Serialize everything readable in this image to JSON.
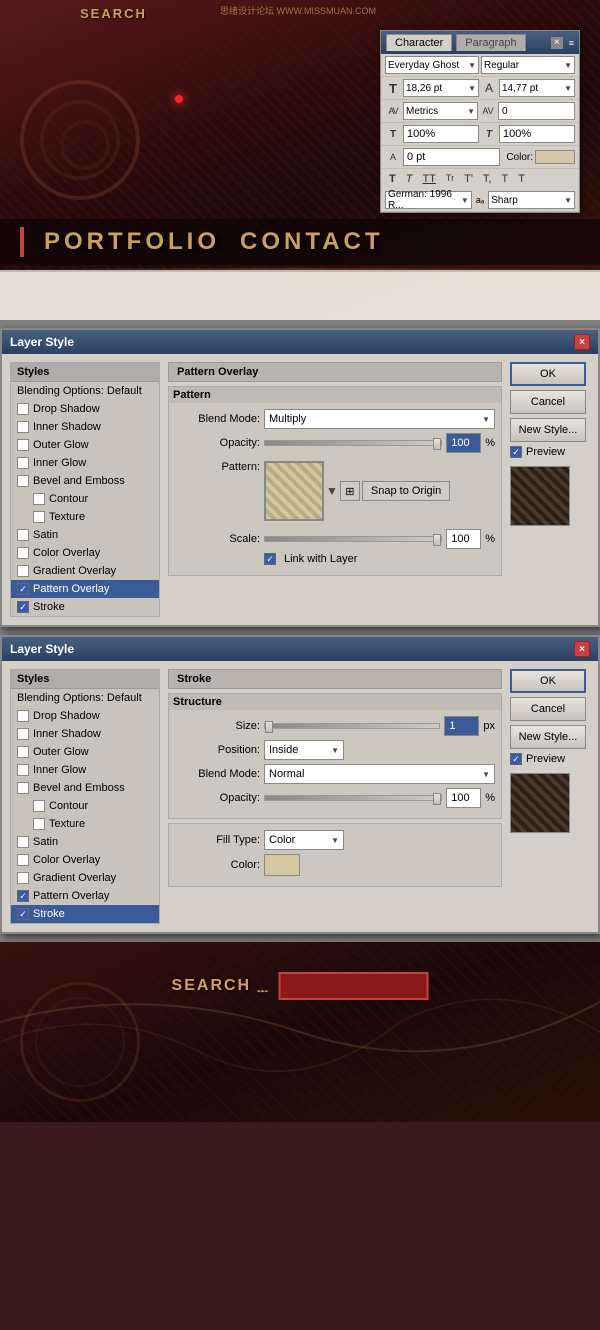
{
  "website": {
    "search_label": "SEARCH",
    "site_title": "思绪设计论坛 WWW.MISSMUAN.COM",
    "nav": {
      "portfolio": "PORTFOLIO",
      "contact": "CONTACT"
    }
  },
  "character_panel": {
    "title": "Character",
    "close": "×",
    "tabs": [
      "Character",
      "Paragraph"
    ],
    "font_family": "Everyday Ghost",
    "font_style": "Regular",
    "font_size": "18,26 pt",
    "leading": "14,77 pt",
    "tracking_label": "AV",
    "tracking_value": "Metrics",
    "kerning_label": "AV",
    "kerning_value": "0",
    "scale_h": "100%",
    "scale_v": "100%",
    "baseline": "0 pt",
    "color_label": "Color:",
    "language": "German: 1996 R...",
    "anti_alias": "Sharp",
    "text_buttons": [
      "T",
      "T",
      "TT",
      "Tr",
      "T'",
      "T,",
      "T",
      "T"
    ]
  },
  "layer_style_1": {
    "title": "Layer Style",
    "active_section": "Pattern Overlay",
    "sections": {
      "header": "Pattern Overlay",
      "sub_header": "Pattern"
    },
    "blend_mode": "Multiply",
    "opacity": "100",
    "opacity_percent": "%",
    "scale": "100",
    "scale_percent": "%",
    "link_layer": "Link with Layer",
    "snap_origin": "Snap to Origin",
    "styles_list": [
      {
        "label": "Styles",
        "type": "header"
      },
      {
        "label": "Blending Options: Default",
        "type": "item"
      },
      {
        "label": "Drop Shadow",
        "type": "checkbox"
      },
      {
        "label": "Inner Shadow",
        "type": "checkbox"
      },
      {
        "label": "Outer Glow",
        "type": "checkbox"
      },
      {
        "label": "Inner Glow",
        "type": "checkbox"
      },
      {
        "label": "Bevel and Emboss",
        "type": "checkbox"
      },
      {
        "label": "Contour",
        "type": "checkbox-indent"
      },
      {
        "label": "Texture",
        "type": "checkbox-indent"
      },
      {
        "label": "Satin",
        "type": "checkbox"
      },
      {
        "label": "Color Overlay",
        "type": "checkbox"
      },
      {
        "label": "Gradient Overlay",
        "type": "checkbox"
      },
      {
        "label": "Pattern Overlay",
        "type": "checkbox-active"
      },
      {
        "label": "Stroke",
        "type": "checkbox"
      }
    ],
    "buttons": {
      "ok": "OK",
      "cancel": "Cancel",
      "new_style": "New Style...",
      "preview": "Preview"
    }
  },
  "layer_style_2": {
    "title": "Layer Style",
    "active_section": "Stroke",
    "sections": {
      "header": "Stroke",
      "sub_header": "Structure"
    },
    "size_value": "1",
    "size_unit": "px",
    "position": "Inside",
    "blend_mode": "Normal",
    "opacity": "100",
    "opacity_percent": "%",
    "fill_type": "Color",
    "styles_list": [
      {
        "label": "Styles",
        "type": "header"
      },
      {
        "label": "Blending Options: Default",
        "type": "item"
      },
      {
        "label": "Drop Shadow",
        "type": "checkbox"
      },
      {
        "label": "Inner Shadow",
        "type": "checkbox"
      },
      {
        "label": "Outer Glow",
        "type": "checkbox"
      },
      {
        "label": "Inner Glow",
        "type": "checkbox"
      },
      {
        "label": "Bevel and Emboss",
        "type": "checkbox"
      },
      {
        "label": "Contour",
        "type": "checkbox-indent"
      },
      {
        "label": "Texture",
        "type": "checkbox-indent"
      },
      {
        "label": "Satin",
        "type": "checkbox"
      },
      {
        "label": "Color Overlay",
        "type": "checkbox"
      },
      {
        "label": "Gradient Overlay",
        "type": "checkbox"
      },
      {
        "label": "Pattern Overlay",
        "type": "checkbox"
      },
      {
        "label": "Stroke",
        "type": "checkbox-active"
      }
    ],
    "buttons": {
      "ok": "OK",
      "cancel": "Cancel",
      "new_style": "New Style...",
      "preview": "Preview"
    }
  },
  "bottom": {
    "search_label": "SEARCH"
  }
}
